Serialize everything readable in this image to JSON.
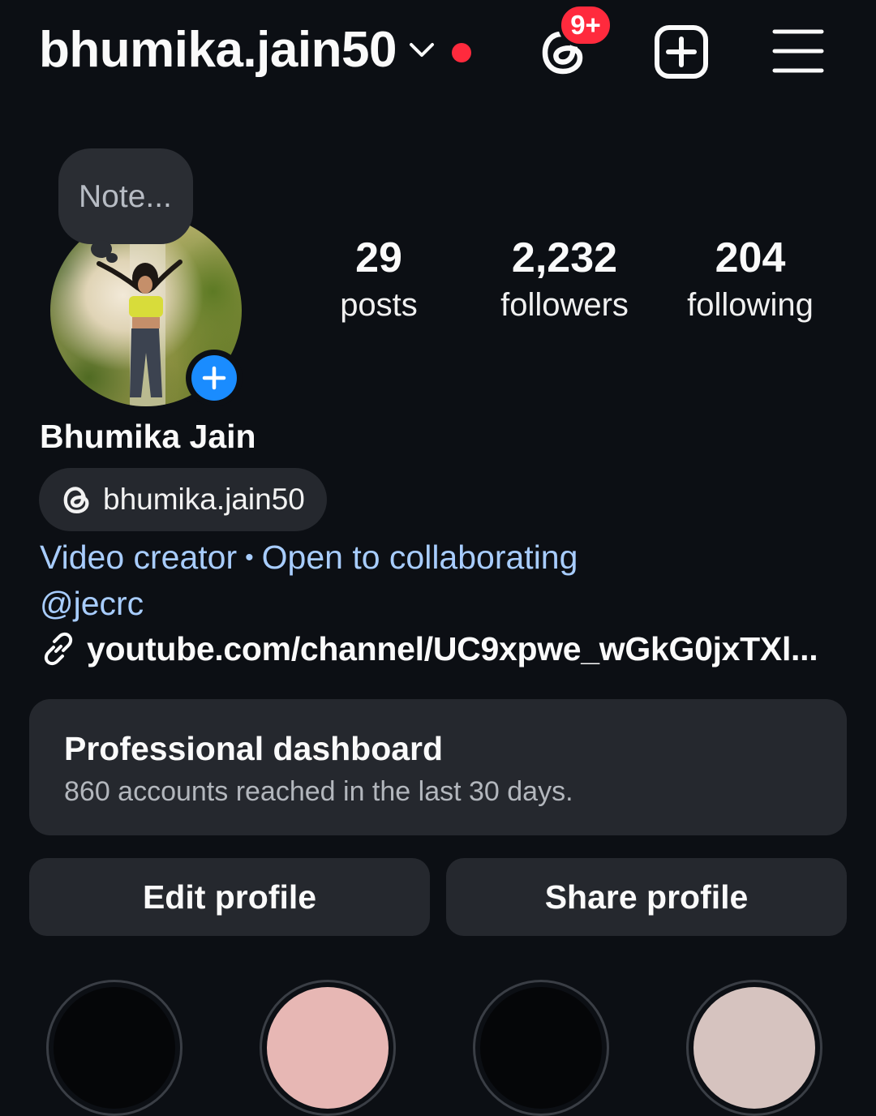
{
  "header": {
    "username": "bhumika.jain50",
    "notification_badge": "9+",
    "accent_red": "#ff2a3d"
  },
  "note": {
    "placeholder": "Note..."
  },
  "stats": [
    {
      "value": "29",
      "label": "posts"
    },
    {
      "value": "2,232",
      "label": "followers"
    },
    {
      "value": "204",
      "label": "following"
    }
  ],
  "profile": {
    "display_name": "Bhumika Jain",
    "threads_handle": "bhumika.jain50",
    "category": "Video creator",
    "category_separator": "•",
    "collab_status": "Open to collaborating",
    "mention": "@jecrc",
    "link": "youtube.com/channel/UC9xpwe_wGkG0jxTXl...",
    "link_color": "#a8cdff"
  },
  "dashboard": {
    "title": "Professional dashboard",
    "subtitle": "860 accounts reached in the last 30 days."
  },
  "actions": {
    "edit_label": "Edit profile",
    "share_label": "Share profile"
  },
  "highlights": [
    {
      "color": "#050608"
    },
    {
      "color": "#e7b7b4"
    },
    {
      "color": "#050608"
    },
    {
      "color": "#d6c3bf"
    }
  ]
}
